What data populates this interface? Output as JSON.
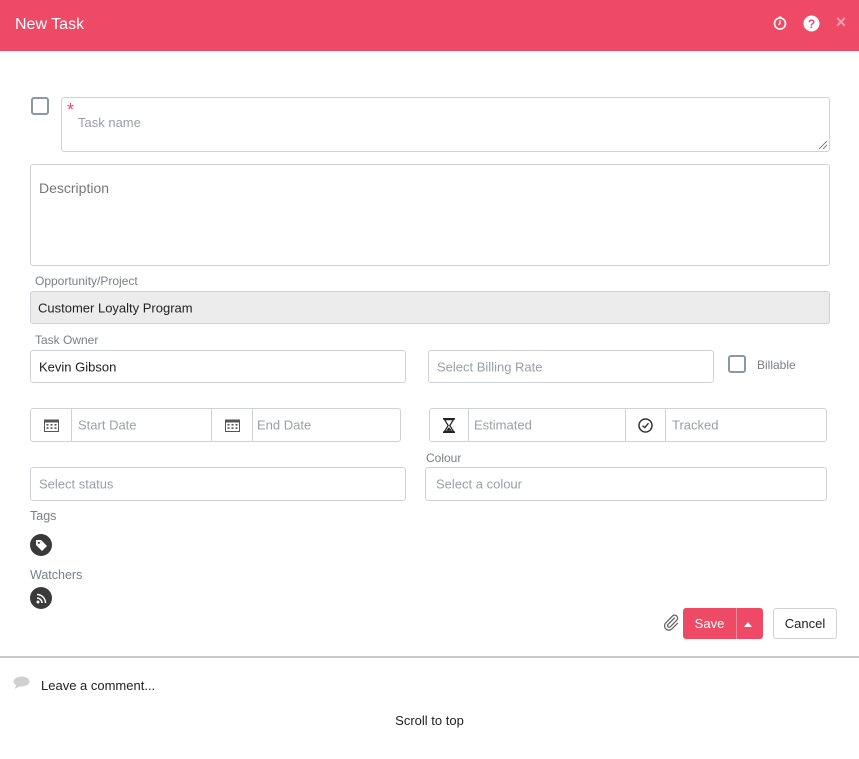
{
  "header": {
    "title": "New Task",
    "icons": [
      "timer-icon",
      "help-icon",
      "close-icon"
    ],
    "close_glyph": "×",
    "accent": "#ee4a66"
  },
  "form": {
    "task_name": {
      "required_mark": "*",
      "placeholder": "Task name"
    },
    "description": {
      "placeholder": "Description"
    },
    "opportunity": {
      "label": "Opportunity/Project",
      "value": "Customer Loyalty Program"
    },
    "task_owner": {
      "label": "Task Owner",
      "value": "Kevin Gibson"
    },
    "billing_rate": {
      "placeholder": "Select Billing Rate"
    },
    "billable": {
      "label": "Billable"
    },
    "start_date": {
      "placeholder": "Start Date"
    },
    "end_date": {
      "placeholder": "End Date"
    },
    "estimated": {
      "placeholder": "Estimated"
    },
    "tracked": {
      "placeholder": "Tracked"
    },
    "status": {
      "placeholder": "Select status"
    },
    "colour": {
      "label": "Colour",
      "placeholder": "Select a colour"
    },
    "tags": {
      "label": "Tags"
    },
    "watchers": {
      "label": "Watchers"
    }
  },
  "actions": {
    "save_label": "Save",
    "cancel_label": "Cancel"
  },
  "comments": {
    "placeholder": "Leave a comment..."
  },
  "footer": {
    "scroll_to_top": "Scroll to top"
  }
}
